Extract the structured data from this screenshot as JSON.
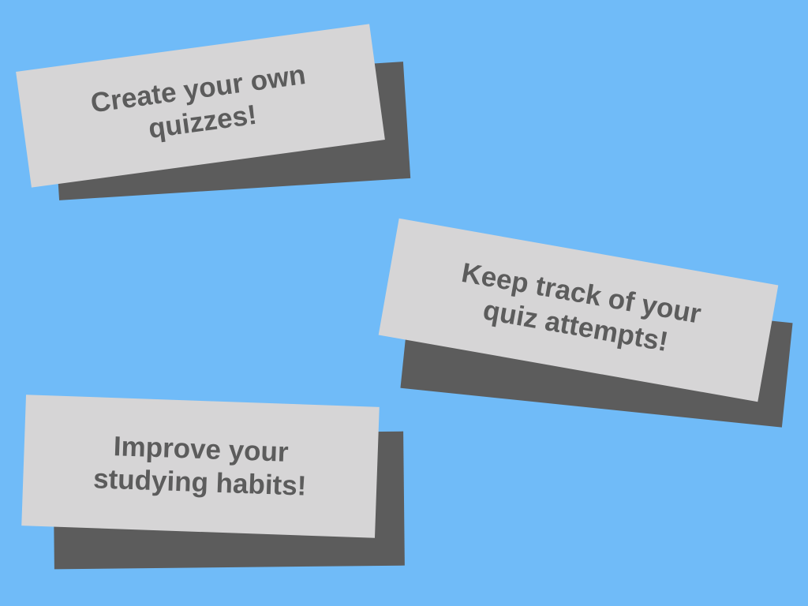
{
  "background_color": "#70bbf8",
  "card_color": "#d6d5d6",
  "shadow_color": "#5c5c5c",
  "text_color": "#5c5c5c",
  "cards": [
    {
      "text": "Create your own\nquizzes!"
    },
    {
      "text": "Keep track of your\nquiz attempts!"
    },
    {
      "text": "Improve your\nstudying habits!"
    }
  ]
}
